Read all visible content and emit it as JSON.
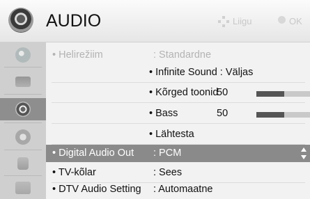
{
  "header": {
    "title": "AUDIO",
    "move_hint": "Liigu",
    "ok_hint": "OK"
  },
  "sidebar": {
    "items": [
      {
        "name": "picture",
        "active": false
      },
      {
        "name": "screen",
        "active": false
      },
      {
        "name": "audio",
        "active": true
      },
      {
        "name": "time",
        "active": false
      },
      {
        "name": "lock",
        "active": false
      },
      {
        "name": "option",
        "active": false
      }
    ]
  },
  "menu": {
    "sound_mode": {
      "label": "• Helirežiim",
      "value": ": Standardne"
    },
    "infinite_sound": "• Infinite Sound : Väljas",
    "treble": {
      "label": "• Kõrged toonid",
      "value": "50",
      "level": 0.5
    },
    "bass": {
      "label": "• Bass",
      "value": "50",
      "level": 0.5
    },
    "reset": "• Lähtesta",
    "digital_audio_out": {
      "label": "• Digital Audio Out",
      "value": ": PCM"
    },
    "tv_speaker": {
      "label": "• TV-kõlar",
      "value": ": Sees"
    },
    "dtv_audio": {
      "label": "• DTV Audio Setting",
      "value": ": Automaatne"
    }
  },
  "colors": {
    "selected_row": "#8a8a8a",
    "bar_fill": "#555555",
    "bar_track": "#c9c9c9"
  }
}
